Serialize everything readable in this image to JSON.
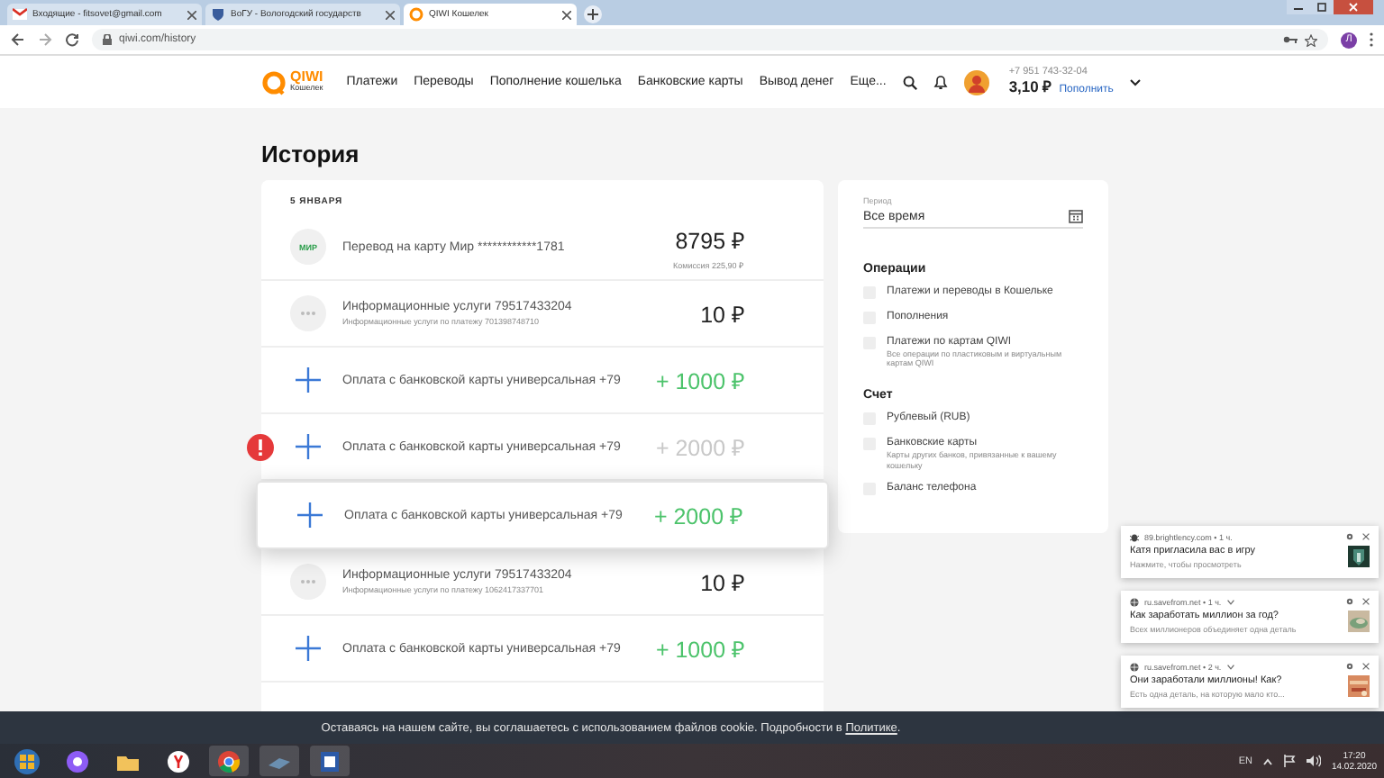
{
  "browser": {
    "tabs": [
      {
        "title": "Входящие - fitsovet@gmail.com",
        "selected": false
      },
      {
        "title": "ВоГУ - Вологодский государств",
        "selected": false
      },
      {
        "title": "QIWI Кошелек",
        "selected": true
      }
    ],
    "url": "qiwi.com/history",
    "profile_initial": "Л"
  },
  "header": {
    "logo": {
      "brand": "QIWI",
      "subtitle": "Кошелек"
    },
    "nav": [
      "Платежи",
      "Переводы",
      "Пополнение кошелька",
      "Банковские карты",
      "Вывод денег",
      "Еще..."
    ],
    "phone": "+7 951 743-32-04",
    "balance": "3,10 ₽",
    "top_up": "Пополнить"
  },
  "page_title": "История",
  "history": {
    "date": "5 ЯНВАРЯ",
    "rows": [
      {
        "kind": "card",
        "icon_text": "МИР",
        "title": "Перевод на карту Мир ************1781",
        "amount": "8795 ₽",
        "note": "Комиссия 225,90 ₽",
        "failed": false,
        "selected": false
      },
      {
        "kind": "service",
        "title": "Информационные услуги 79517433204",
        "subtitle": "Информационные услуги по платежу 701398748710",
        "amount": "10 ₽",
        "failed": false,
        "selected": false
      },
      {
        "kind": "topup",
        "title": "Оплата с банковской карты универсальная +79",
        "amount": "+ 1000 ₽",
        "failed": false,
        "selected": false
      },
      {
        "kind": "topup",
        "title": "Оплата с банковской карты универсальная +79",
        "amount": "+ 2000 ₽",
        "failed": true,
        "selected": false
      },
      {
        "kind": "topup",
        "title": "Оплата с банковской карты универсальная +79",
        "amount": "+ 2000 ₽",
        "failed": false,
        "selected": true
      },
      {
        "kind": "service",
        "title": "Информационные услуги 79517433204",
        "subtitle": "Информационные услуги по платежу 1062417337701",
        "amount": "10 ₽",
        "failed": false,
        "selected": false
      },
      {
        "kind": "topup",
        "title": "Оплата с банковской карты универсальная +79",
        "amount": "+ 1000 ₽",
        "failed": false,
        "selected": false
      }
    ]
  },
  "filters": {
    "period": {
      "label": "Период",
      "value": "Все время"
    },
    "groups": [
      {
        "title": "Операции",
        "options": [
          {
            "label": "Платежи и переводы в Кошельке",
            "checked": false
          },
          {
            "label": "Пополнения",
            "checked": false
          },
          {
            "label": "Платежи по картам QIWI",
            "hint": "Все операции по пластиковым и виртуальным картам QIWI",
            "checked": false
          }
        ]
      },
      {
        "title": "Счет",
        "options": [
          {
            "label": "Рублевый (RUB)",
            "checked": false
          },
          {
            "label": "Банковские карты",
            "hint": "Карты других банков, привязанные к вашему кошельку",
            "checked": false
          },
          {
            "label": "Баланс телефона",
            "checked": false
          }
        ]
      }
    ]
  },
  "notifications": [
    {
      "source": "89.brightlency.com • 1 ч.",
      "title": "Катя пригласила вас в игру",
      "body": "Нажмите, чтобы просмотреть",
      "menu": false
    },
    {
      "source": "ru.savefrom.net • 1 ч.",
      "title": "Как заработать миллион за год?",
      "body": "Всех миллионеров объединяет одна деталь",
      "menu": true
    },
    {
      "source": "ru.savefrom.net • 2 ч.",
      "title": "Они заработали миллионы! Как?",
      "body": "Есть одна деталь, на которую мало кто...",
      "menu": true
    }
  ],
  "cookie": {
    "text": "Оставаясь на нашем сайте, вы соглашаетесь с использованием файлов cookie. Подробности в ",
    "link": "Политике",
    "end": "."
  },
  "taskbar": {
    "language": "EN",
    "time": "17:20",
    "date": "14.02.2020"
  }
}
